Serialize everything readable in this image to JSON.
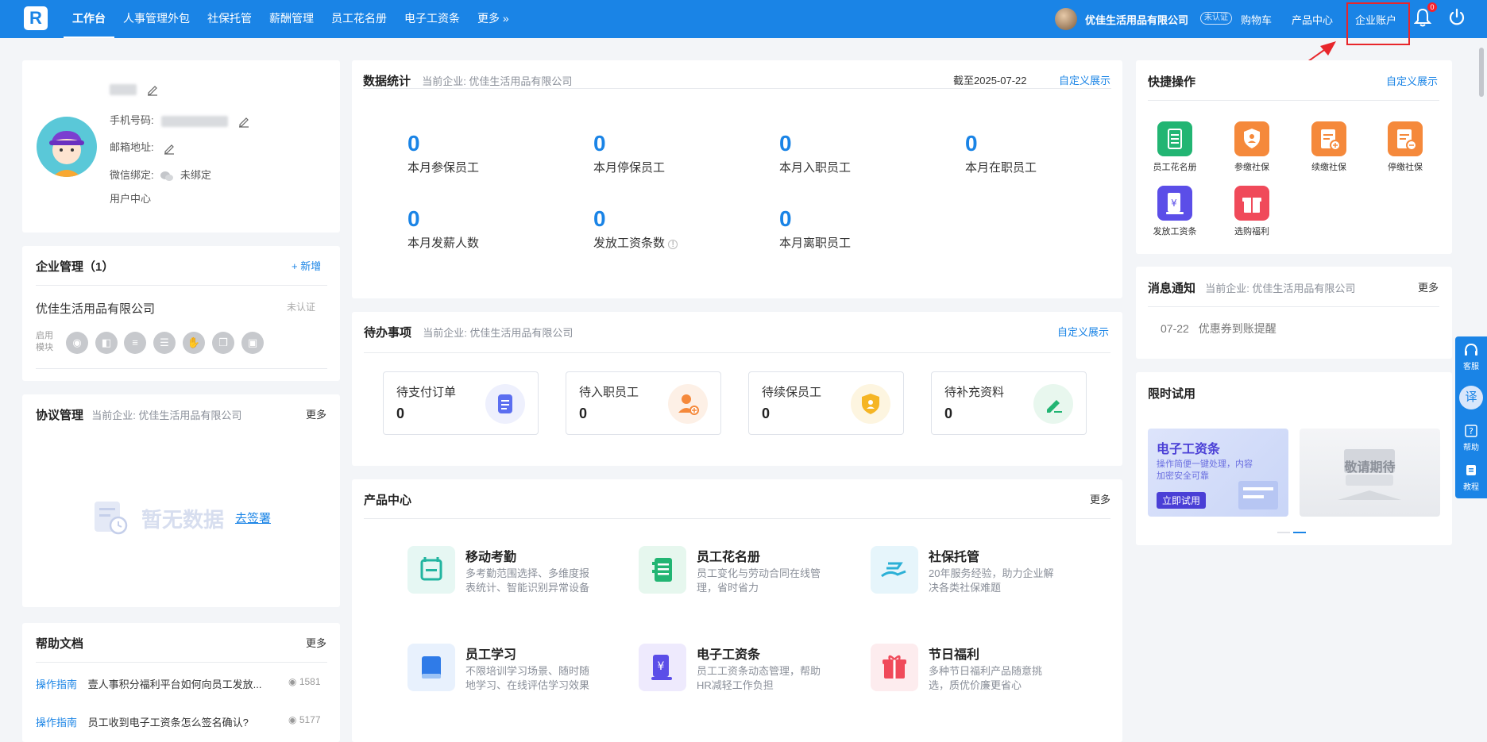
{
  "nav": {
    "logo": "R",
    "items": [
      "工作台",
      "人事管理外包",
      "社保托管",
      "薪酬管理",
      "员工花名册",
      "电子工资条",
      "更多 »"
    ],
    "company_name": "优佳生活用品有限公司",
    "verify_badge": "未认证",
    "cart": "购物车",
    "product_center": "产品中心",
    "enterprise_account": "企业账户",
    "notification_count": "0"
  },
  "profile": {
    "phone_label": "手机号码:",
    "email_label": "邮箱地址:",
    "wechat_label": "微信绑定:",
    "wechat_status": "未绑定",
    "user_center": "用户中心"
  },
  "enterprise": {
    "title": "企业管理（1）",
    "add": "+ 新增",
    "company": "优佳生活用品有限公司",
    "status": "未认证",
    "modules_label_1": "启用",
    "modules_label_2": "模块"
  },
  "agreement": {
    "title": "协议管理",
    "sub": "当前企业: 优佳生活用品有限公司",
    "more": "更多",
    "empty": "暂无数据",
    "go_sign": "去签署"
  },
  "help": {
    "title": "帮助文档",
    "more": "更多",
    "items": [
      {
        "tag": "操作指南",
        "text": "壹人事积分福利平台如何向员工发放...",
        "views": "1581"
      },
      {
        "tag": "操作指南",
        "text": "员工收到电子工资条怎么签名确认?",
        "views": "5177"
      }
    ]
  },
  "stats": {
    "title": "数据统计",
    "sub": "当前企业: 优佳生活用品有限公司",
    "date": "截至2025-07-22",
    "customize": "自定义展示",
    "items": [
      {
        "value": "0",
        "label": "本月参保员工"
      },
      {
        "value": "0",
        "label": "本月停保员工"
      },
      {
        "value": "0",
        "label": "本月入职员工"
      },
      {
        "value": "0",
        "label": "本月在职员工"
      },
      {
        "value": "0",
        "label": "本月发薪人数"
      },
      {
        "value": "0",
        "label": "发放工资条数"
      },
      {
        "value": "0",
        "label": "本月离职员工"
      }
    ]
  },
  "todo": {
    "title": "待办事项",
    "sub": "当前企业: 优佳生活用品有限公司",
    "customize": "自定义展示",
    "items": [
      {
        "label": "待支付订单",
        "value": "0"
      },
      {
        "label": "待入职员工",
        "value": "0"
      },
      {
        "label": "待续保员工",
        "value": "0"
      },
      {
        "label": "待补充资料",
        "value": "0"
      }
    ]
  },
  "products": {
    "title": "产品中心",
    "more": "更多",
    "items": [
      {
        "name": "移动考勤",
        "desc": "多考勤范围选择、多维度报表统计、智能识别异常设备"
      },
      {
        "name": "员工花名册",
        "desc": "员工变化与劳动合同在线管理，省时省力"
      },
      {
        "name": "社保托管",
        "desc": "20年服务经验，助力企业解决各类社保难题"
      },
      {
        "name": "员工学习",
        "desc": "不限培训学习场景、随时随地学习、在线评估学习效果"
      },
      {
        "name": "电子工资条",
        "desc": "员工工资条动态管理，帮助HR减轻工作负担"
      },
      {
        "name": "节日福利",
        "desc": "多种节日福利产品随意挑选，质优价廉更省心"
      }
    ]
  },
  "quick": {
    "title": "快捷操作",
    "customize": "自定义展示",
    "items": [
      {
        "label": "员工花名册",
        "color": "#22b573"
      },
      {
        "label": "参缴社保",
        "color": "#f5893b"
      },
      {
        "label": "续缴社保",
        "color": "#f5893b"
      },
      {
        "label": "停缴社保",
        "color": "#f5893b"
      },
      {
        "label": "发放工资条",
        "color": "#5b4ee8"
      },
      {
        "label": "选购福利",
        "color": "#f04a5a"
      }
    ]
  },
  "messages": {
    "title": "消息通知",
    "sub": "当前企业: 优佳生活用品有限公司",
    "more": "更多",
    "items": [
      {
        "date": "07-22",
        "text": "优惠券到账提醒"
      }
    ]
  },
  "trial": {
    "title": "限时试用",
    "banner_title": "电子工资条",
    "banner_desc": "操作简便一键处理，内容加密安全可靠",
    "banner_btn": "立即试用",
    "banner2_text": "敬请期待"
  },
  "float_bar": [
    "客服",
    "译",
    "帮助",
    "教程"
  ]
}
